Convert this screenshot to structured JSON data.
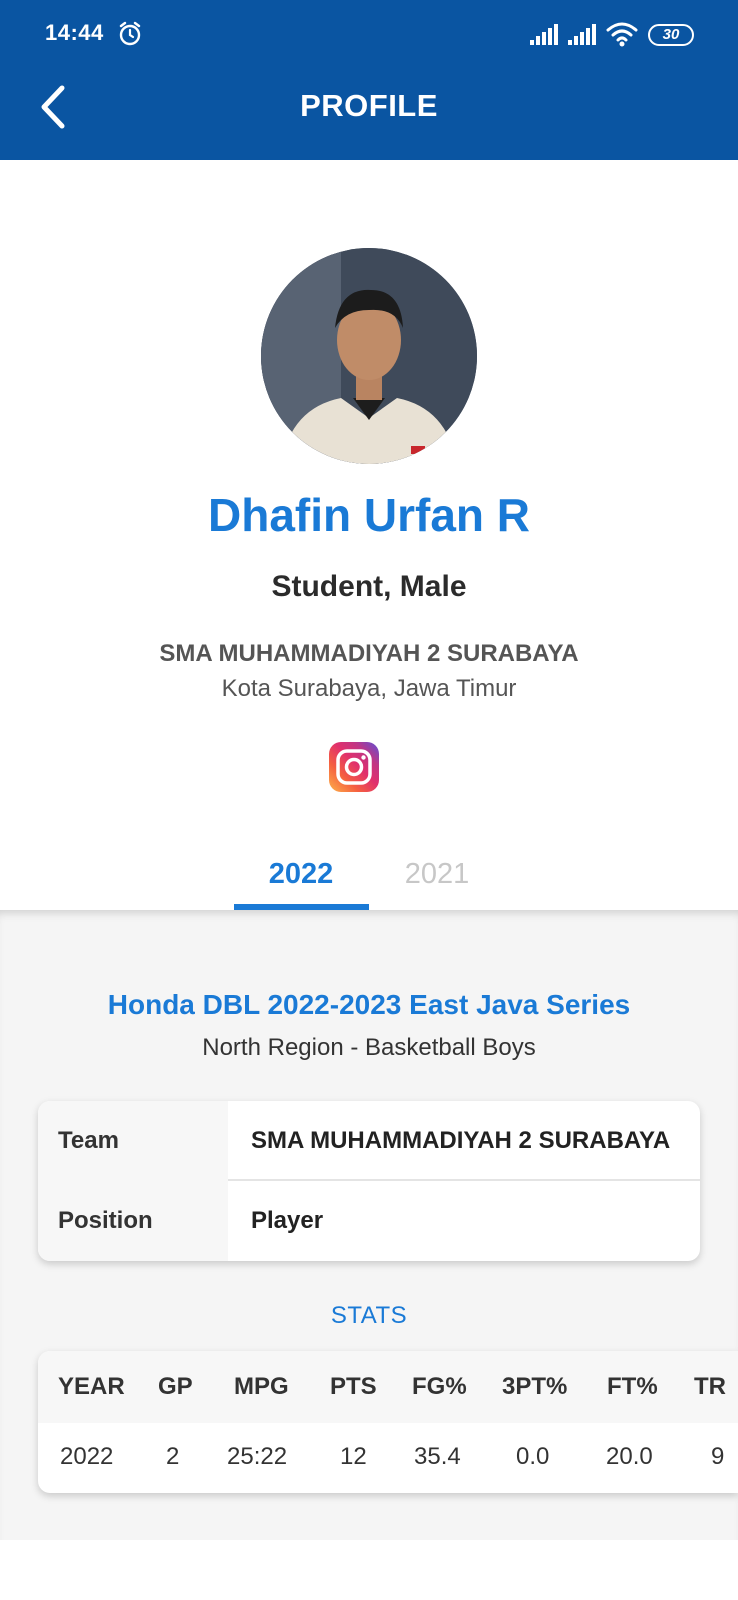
{
  "status_bar": {
    "time": "14:44",
    "battery": "30"
  },
  "header": {
    "title": "PROFILE",
    "back_icon": "chevron-left-icon"
  },
  "profile": {
    "name": "Dhafin Urfan R",
    "subtitle": "Student, Male",
    "school": "SMA MUHAMMADIYAH 2 SURABAYA",
    "location": "Kota Surabaya, Jawa Timur",
    "social_icon": "instagram-icon"
  },
  "tabs": [
    {
      "label": "2022",
      "active": true
    },
    {
      "label": "2021",
      "active": false
    }
  ],
  "event": {
    "title": "Honda DBL 2022-2023 East Java Series",
    "subtitle": "North Region - Basketball Boys"
  },
  "info": [
    {
      "label": "Team",
      "value": "SMA MUHAMMADIYAH 2 SURABAYA"
    },
    {
      "label": "Position",
      "value": "Player"
    }
  ],
  "stats": {
    "label": "STATS",
    "columns": [
      "YEAR",
      "GP",
      "MPG",
      "PTS",
      "FG%",
      "3PT%",
      "FT%",
      "TR"
    ],
    "rows": [
      [
        "2022",
        "2",
        "25:22",
        "12",
        "35.4",
        "0.0",
        "20.0",
        "9"
      ]
    ]
  },
  "colors": {
    "header_bg": "#0a55a2",
    "accent": "#1a7ad6",
    "tab_inactive": "#c7c7c7",
    "content_bg": "#f5f5f5"
  }
}
